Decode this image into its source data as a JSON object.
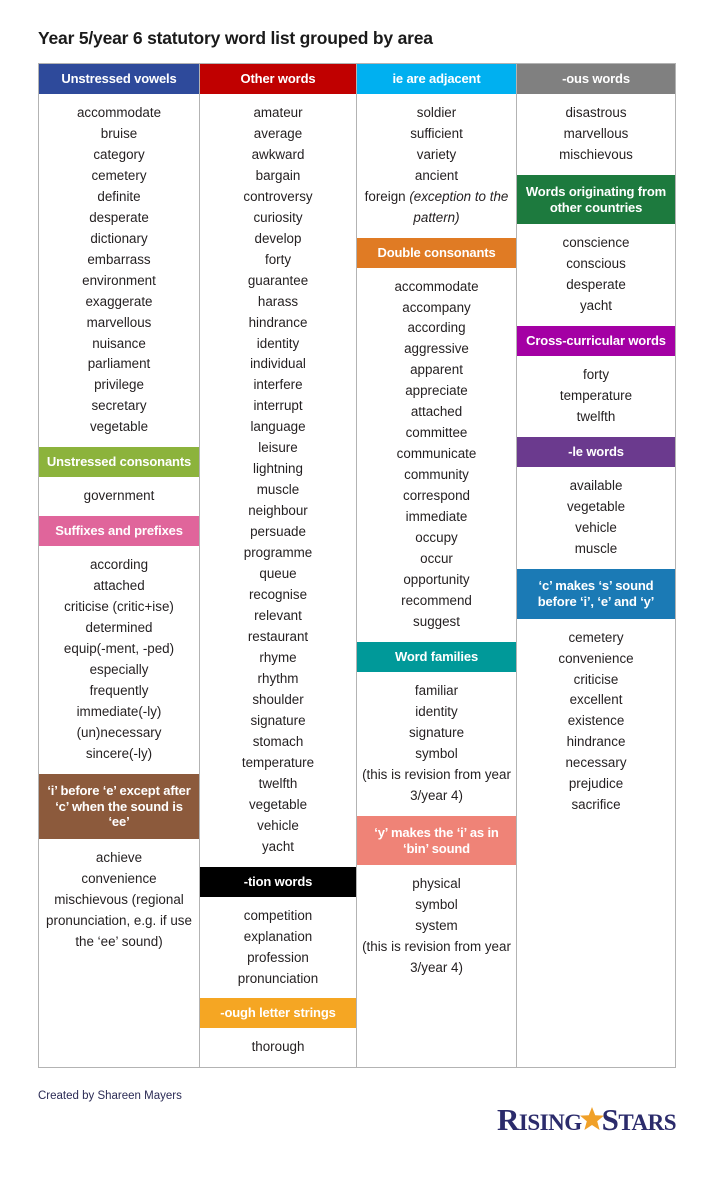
{
  "title": "Year 5/year 6 statutory word list grouped by area",
  "footer": {
    "credit": "Created by Shareen Mayers",
    "logo": {
      "word1": "R",
      "word1_rest": "ISING",
      "word2": "S",
      "word2_rest": "TARS",
      "star_color": "#f0a028",
      "text_color": "#2b2b6b"
    }
  },
  "colors": {
    "unstressed_vowels": "#2e4a9b",
    "other_words": "#c00000",
    "ie_are_adjacent": "#00b0f0",
    "ous_words": "#808080",
    "unstressed_consonants": "#8cb33c",
    "suffixes_and_prefixes": "#e0659b",
    "i_before_e": "#8c5a3c",
    "tion_words": "#000000",
    "ough_letter_strings": "#f5a623",
    "double_consonants": "#e07b24",
    "word_families": "#009999",
    "y_makes_i": "#ef8377",
    "words_originating": "#1d7a3e",
    "cross_curricular": "#a400a4",
    "le_words": "#6b3a8e",
    "c_makes_s": "#1b7ab5"
  },
  "columns": [
    {
      "id": "col-1",
      "sections": [
        {
          "header": "Unstressed vowels",
          "color_key": "unstressed_vowels",
          "words": [
            "accommodate",
            "bruise",
            "category",
            "cemetery",
            "definite",
            "desperate",
            "dictionary",
            "embarrass",
            "environment",
            "exaggerate",
            "marvellous",
            "nuisance",
            "parliament",
            "privilege",
            "secretary",
            "vegetable"
          ]
        },
        {
          "header": "Unstressed consonants",
          "color_key": "unstressed_consonants",
          "words": [
            "government"
          ]
        },
        {
          "header": "Suffixes and prefixes",
          "color_key": "suffixes_and_prefixes",
          "words": [
            "according",
            "attached",
            "criticise (critic+ise)",
            "determined",
            "equip(-ment, -ped)",
            "especially",
            "frequently",
            "immediate(-ly)",
            "(un)necessary",
            "sincere(-ly)"
          ]
        },
        {
          "header": "‘i’ before ‘e’ except after ‘c’ when the sound is ‘ee’",
          "color_key": "i_before_e",
          "words": [
            "achieve",
            "convenience",
            "mischievous (regional pronunciation, e.g. if use the ‘ee’ sound)"
          ]
        }
      ]
    },
    {
      "id": "col-2",
      "sections": [
        {
          "header": "Other words",
          "color_key": "other_words",
          "words": [
            "amateur",
            "average",
            "awkward",
            "bargain",
            "controversy",
            "curiosity",
            "develop",
            "forty",
            "guarantee",
            "harass",
            "hindrance",
            "identity",
            "individual",
            "interfere",
            "interrupt",
            "language",
            "leisure",
            "lightning",
            "muscle",
            "neighbour",
            "persuade",
            "programme",
            "queue",
            "recognise",
            "relevant",
            "restaurant",
            "rhyme",
            "rhythm",
            "shoulder",
            "signature",
            "stomach",
            "temperature",
            "twelfth",
            "vegetable",
            "vehicle",
            "yacht"
          ]
        },
        {
          "header": "-tion words",
          "color_key": "tion_words",
          "words": [
            "competition",
            "explanation",
            "profession",
            "pronunciation"
          ]
        },
        {
          "header": "-ough letter strings",
          "color_key": "ough_letter_strings",
          "words": [
            "thorough"
          ]
        }
      ]
    },
    {
      "id": "col-3",
      "sections": [
        {
          "header": "ie are adjacent",
          "color_key": "ie_are_adjacent",
          "words": [
            "soldier",
            "sufficient",
            "variety",
            "ancient",
            "foreign (exception to the pattern)"
          ],
          "italic_from": "(exception"
        },
        {
          "header": "Double consonants",
          "color_key": "double_consonants",
          "words": [
            "accommodate",
            "accompany",
            "according",
            "aggressive",
            "apparent",
            "appreciate",
            "attached",
            "committee",
            "communicate",
            "community",
            "correspond",
            "immediate",
            "occupy",
            "occur",
            "opportunity",
            "recommend",
            "suggest"
          ]
        },
        {
          "header": "Word families",
          "color_key": "word_families",
          "words": [
            "familiar",
            "identity",
            "signature",
            "symbol",
            "(this is revision from year 3/year 4)"
          ]
        },
        {
          "header": "‘y’ makes the ‘i’ as in ‘bin’ sound",
          "color_key": "y_makes_i",
          "words": [
            "physical",
            "symbol",
            "system",
            "(this is revision from year 3/year 4)"
          ]
        }
      ]
    },
    {
      "id": "col-4",
      "sections": [
        {
          "header": "-ous words",
          "color_key": "ous_words",
          "words": [
            "disastrous",
            "marvellous",
            "mischievous"
          ]
        },
        {
          "header": "Words originating from other countries",
          "color_key": "words_originating",
          "words": [
            "conscience",
            "conscious",
            "desperate",
            "yacht"
          ]
        },
        {
          "header": "Cross-curricular words",
          "color_key": "cross_curricular",
          "words": [
            "forty",
            "temperature",
            "twelfth"
          ]
        },
        {
          "header": "-le words",
          "color_key": "le_words",
          "words": [
            "available",
            "vegetable",
            "vehicle",
            "muscle"
          ]
        },
        {
          "header": "‘c’ makes ‘s’ sound before ‘i’, ‘e’ and ‘y’",
          "color_key": "c_makes_s",
          "words": [
            "cemetery",
            "convenience",
            "criticise",
            "excellent",
            "existence",
            "hindrance",
            "necessary",
            "prejudice",
            "sacrifice"
          ]
        }
      ]
    }
  ]
}
